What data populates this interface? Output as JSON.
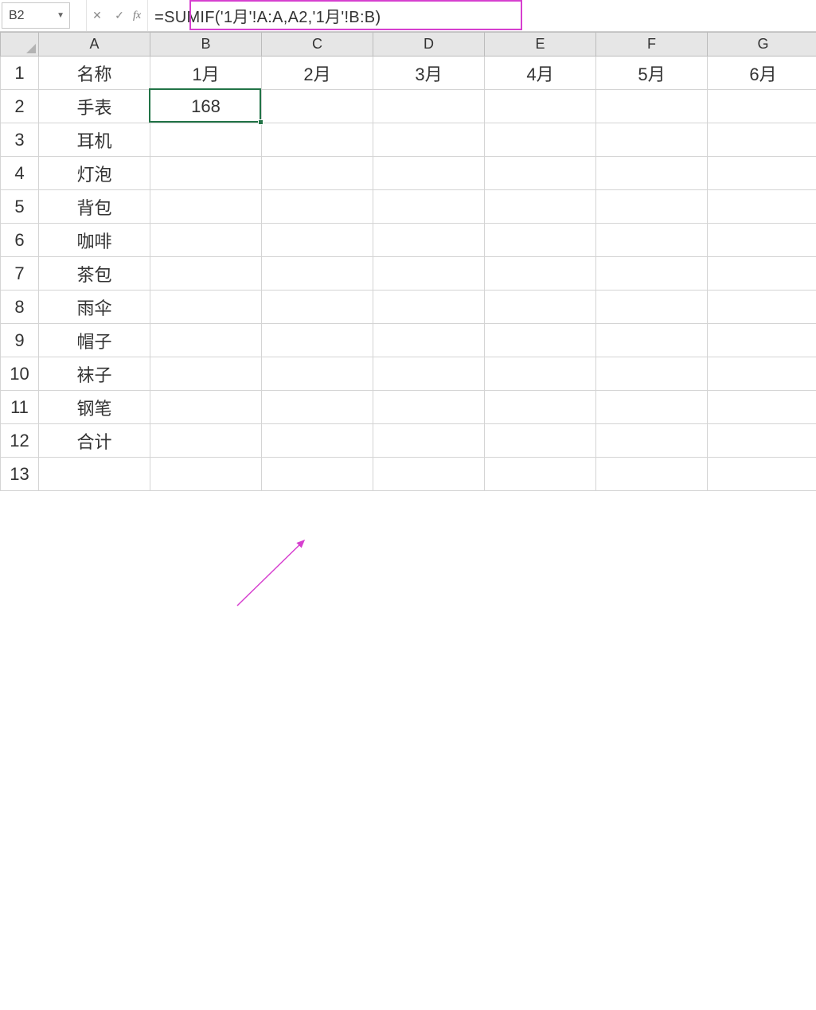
{
  "namebox": {
    "value": "B2"
  },
  "formula_bar": {
    "cancel": "✕",
    "confirm": "✓",
    "fx": "fx",
    "formula": "=SUMIF('1月'!A:A,A2,'1月'!B:B)"
  },
  "columns": [
    "A",
    "B",
    "C",
    "D",
    "E",
    "F",
    "G"
  ],
  "row_numbers": [
    "1",
    "2",
    "3",
    "4",
    "5",
    "6",
    "7",
    "8",
    "9",
    "10",
    "11",
    "12",
    "13"
  ],
  "rows": [
    [
      "名称",
      "1月",
      "2月",
      "3月",
      "4月",
      "5月",
      "6月"
    ],
    [
      "手表",
      "168",
      "",
      "",
      "",
      "",
      ""
    ],
    [
      "耳机",
      "",
      "",
      "",
      "",
      "",
      ""
    ],
    [
      "灯泡",
      "",
      "",
      "",
      "",
      "",
      ""
    ],
    [
      "背包",
      "",
      "",
      "",
      "",
      "",
      ""
    ],
    [
      "咖啡",
      "",
      "",
      "",
      "",
      "",
      ""
    ],
    [
      "茶包",
      "",
      "",
      "",
      "",
      "",
      ""
    ],
    [
      "雨伞",
      "",
      "",
      "",
      "",
      "",
      ""
    ],
    [
      "帽子",
      "",
      "",
      "",
      "",
      "",
      ""
    ],
    [
      "袜子",
      "",
      "",
      "",
      "",
      "",
      ""
    ],
    [
      "钢笔",
      "",
      "",
      "",
      "",
      "",
      ""
    ],
    [
      "合计",
      "",
      "",
      "",
      "",
      "",
      ""
    ],
    [
      "",
      "",
      "",
      "",
      "",
      "",
      ""
    ]
  ],
  "active": {
    "row": 2,
    "col": "B"
  }
}
